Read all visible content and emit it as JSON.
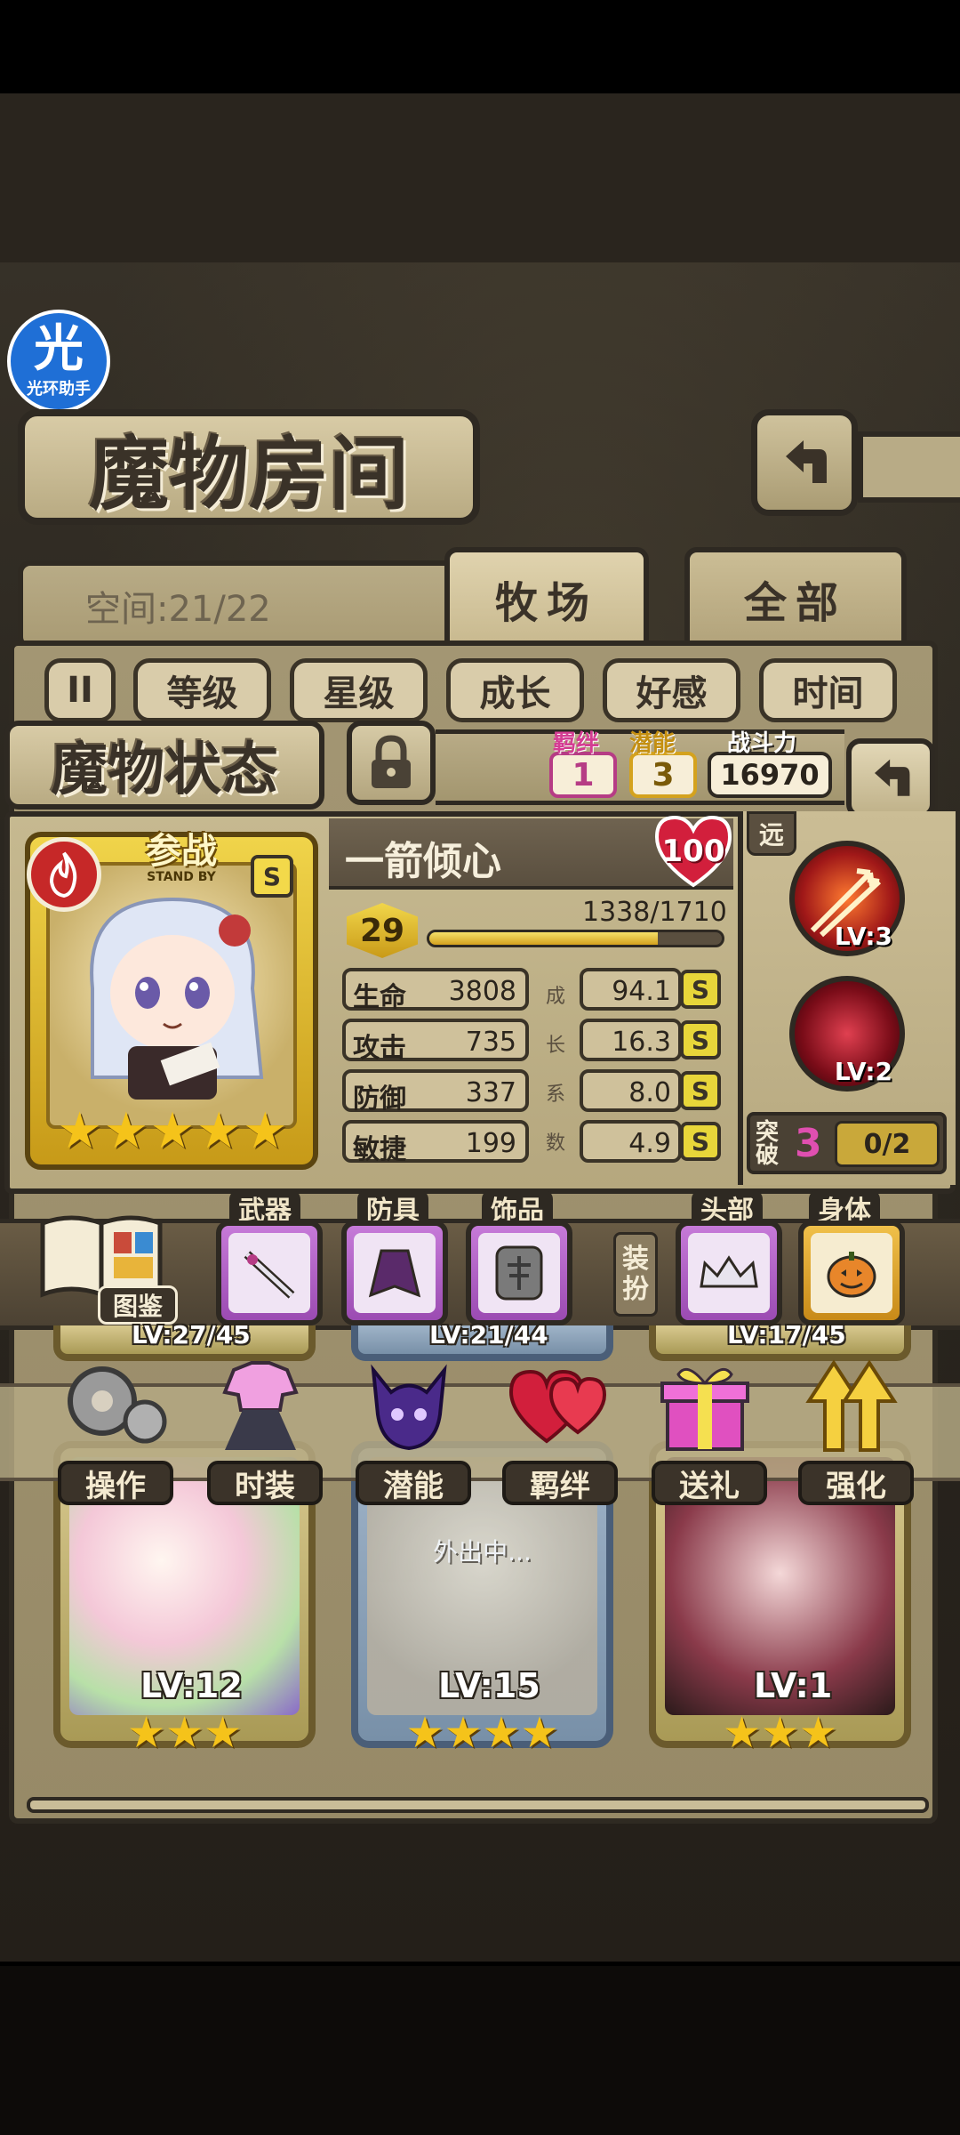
{
  "overlay_badge": {
    "glyph": "光",
    "label": "光环助手"
  },
  "header": {
    "title": "魔物房间",
    "back_icon": "back-arrow-icon"
  },
  "space": {
    "label": "空间:21/22"
  },
  "tabs": [
    {
      "label": "牧场"
    },
    {
      "label": "全部"
    }
  ],
  "filters": {
    "pause_glyph": "II",
    "items": [
      "等级",
      "星级",
      "成长",
      "好感",
      "时间"
    ]
  },
  "status": {
    "title": "魔物状态",
    "bond_label": "羁绊",
    "bond_value": "1",
    "potential_label": "潜能",
    "potential_value": "3",
    "power_label": "战斗力",
    "power_value": "16970"
  },
  "monster": {
    "name": "一箭倾心",
    "affection": "100",
    "standby_label": "参战",
    "standby_sub": "STAND BY",
    "grade_badge": "S",
    "stars": 5,
    "level": "29",
    "exp_text": "1338/1710",
    "exp_fraction": 0.78
  },
  "stats": [
    {
      "label": "生命",
      "value": "3808",
      "growth": "94.1",
      "grade": "S"
    },
    {
      "label": "攻击",
      "value": "735",
      "growth": "16.3",
      "grade": "S"
    },
    {
      "label": "防御",
      "value": "337",
      "growth": "8.0",
      "grade": "S"
    },
    {
      "label": "敏捷",
      "value": "199",
      "growth": "4.9",
      "grade": "S"
    }
  ],
  "growth_vertical": [
    "成",
    "长",
    "系",
    "数"
  ],
  "skills": {
    "range_label": "远",
    "items": [
      {
        "level": "LV:3"
      },
      {
        "level": "LV:2"
      }
    ],
    "breakthrough_label": "突破",
    "breakthrough_value": "3",
    "breakthrough_progress": "0/2"
  },
  "equipment": {
    "codex_label": "图鉴",
    "slots": [
      {
        "label": "武器"
      },
      {
        "label": "防具"
      },
      {
        "label": "饰品"
      }
    ],
    "dress_label": "装扮",
    "dress_slots": [
      {
        "label": "头部"
      },
      {
        "label": "身体"
      }
    ]
  },
  "actions": [
    {
      "label": "操作",
      "icon": "gear-icon"
    },
    {
      "label": "时装",
      "icon": "outfit-icon"
    },
    {
      "label": "潜能",
      "icon": "demon-icon"
    },
    {
      "label": "羁绊",
      "icon": "hearts-icon"
    },
    {
      "label": "送礼",
      "icon": "gift-icon"
    },
    {
      "label": "强化",
      "icon": "up-arrows-icon"
    }
  ],
  "top_cards": [
    {
      "level": "LV:27/45"
    },
    {
      "level": "LV:21/44"
    },
    {
      "level": "LV:17/45"
    }
  ],
  "cards": [
    {
      "level": "LV:12",
      "stars": 3,
      "status": ""
    },
    {
      "level": "LV:15",
      "stars": 4,
      "status": "外出中..."
    },
    {
      "level": "LV:1",
      "stars": 3,
      "status": ""
    }
  ],
  "colors": {
    "accent_gold": "#e8d63a",
    "parchment": "#b8ab86",
    "frame_dark": "#2e2922",
    "affection_red": "#d21f3c"
  }
}
